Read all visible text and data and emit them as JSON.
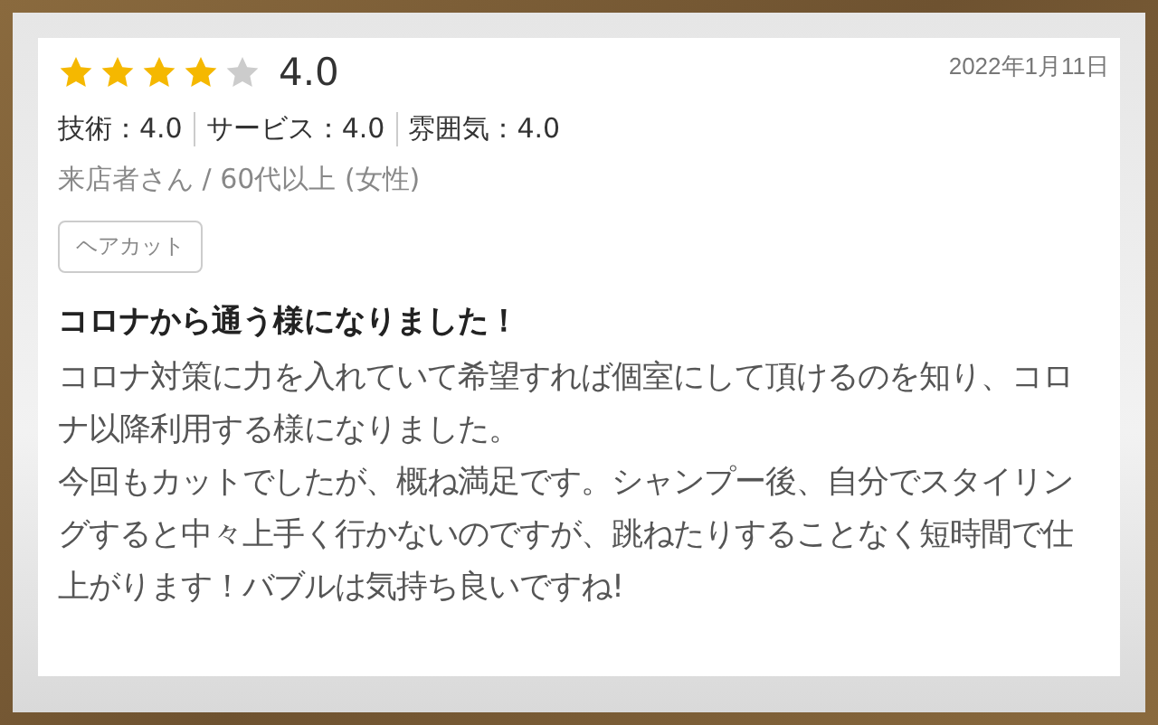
{
  "review": {
    "stars": 4,
    "score": "4.0",
    "date": "2022年1月11日",
    "sub_ratings": [
      {
        "label": "技術：4.0"
      },
      {
        "label": "サービス：4.0"
      },
      {
        "label": "雰囲気：4.0"
      }
    ],
    "reviewer": "来店者さん / 60代以上 (女性)",
    "tags": [
      "ヘアカット"
    ],
    "title": "コロナから通う様になりました！",
    "paragraphs": [
      "コロナ対策に力を入れていて希望すれば個室にして頂けるのを知り、コロナ以降利用する様になりました。",
      "今回もカットでしたが、概ね満足です。シャンプー後、自分でスタイリングすると中々上手く行かないのですが、跳ねたりすることなく短時間で仕上がります！バブルは気持ち良いですね!"
    ]
  }
}
